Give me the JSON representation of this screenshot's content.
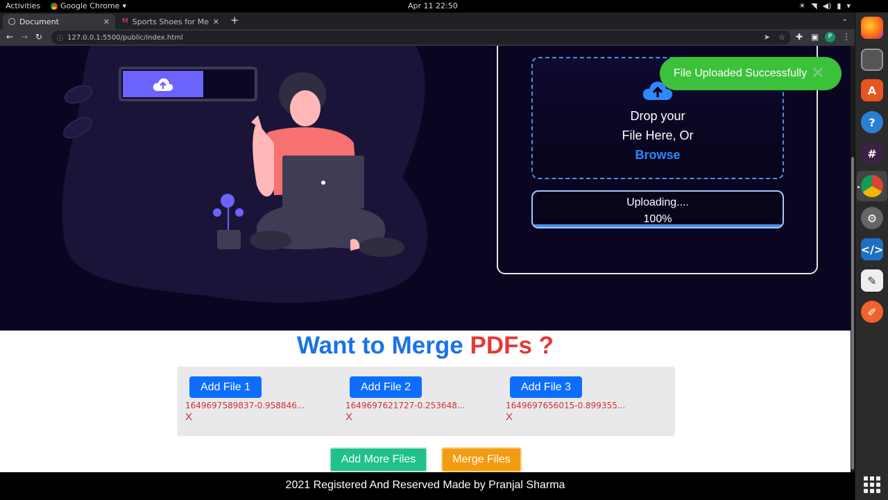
{
  "system": {
    "activities": "Activities",
    "app_name": "Google Chrome",
    "clock": "Apr 11  22:50"
  },
  "browser": {
    "tabs": [
      {
        "title": "Document",
        "active": true
      },
      {
        "title": "Sports Shoes for Men - Bu",
        "active": false
      }
    ],
    "url": "127.0.0.1:5500/public/index.html",
    "profile_initial": "P"
  },
  "upload": {
    "drop_line1": "Drop your",
    "drop_line2": "File Here, Or",
    "browse": "Browse",
    "status": "Uploading....",
    "percent": "100%",
    "progress": 1.0
  },
  "toast": {
    "message": "File Uploaded Successfully",
    "close": "✕"
  },
  "merge": {
    "title_part1": "Want to Merge",
    "title_part2": "PDFs ?",
    "files": [
      {
        "button": "Add File 1",
        "name": "1649697589837-0.958846...",
        "remove": "X"
      },
      {
        "button": "Add File 2",
        "name": "1649697621727-0.253648...",
        "remove": "X"
      },
      {
        "button": "Add File 3",
        "name": "1649697656015-0.899355...",
        "remove": "X"
      }
    ],
    "add_more": "Add More Files",
    "merge_btn": "Merge Files"
  },
  "footer": {
    "text": "2021 Registered And Reserved Made by Pranjal Sharma"
  },
  "colors": {
    "hero_bg": "#0a0622",
    "accent_blue": "#1a73e8",
    "accent_red": "#e53935",
    "toast_green": "#3cc13b",
    "add_btn": "#0d6efd",
    "more_btn": "#20c08a",
    "merge_btn": "#f39c12"
  },
  "dock_icons": [
    "firefox-icon",
    "files-icon",
    "software-center-icon",
    "help-icon",
    "slack-icon",
    "chrome-icon",
    "settings-icon",
    "vscode-icon",
    "text-editor-icon",
    "pencil-app-icon",
    "show-apps-icon"
  ]
}
